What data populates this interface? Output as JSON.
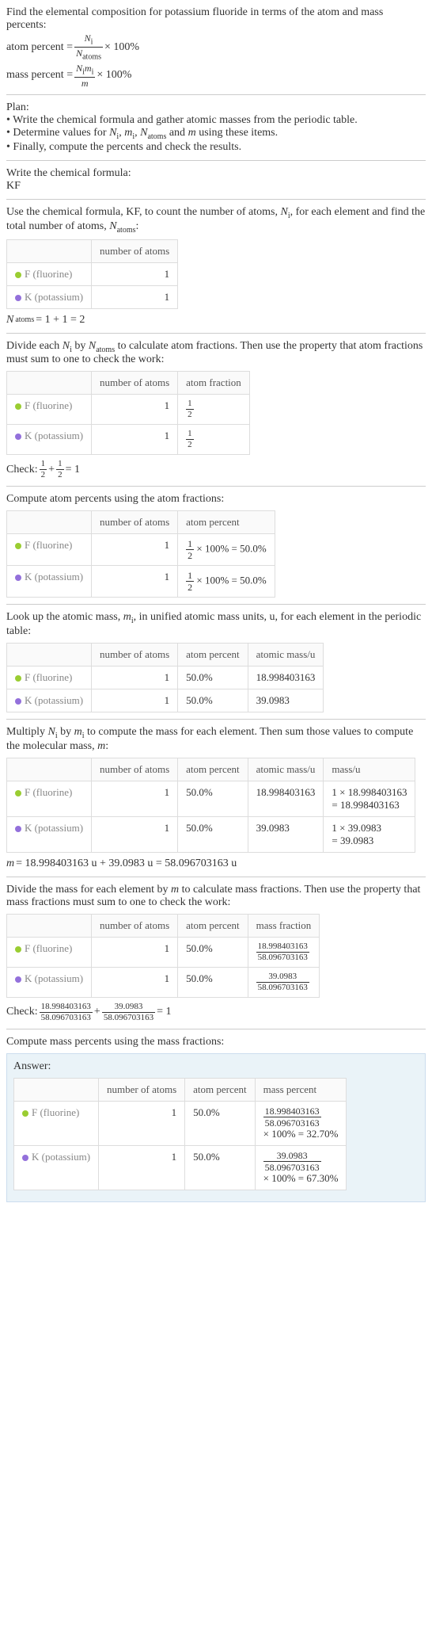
{
  "intro": {
    "title": "Find the elemental composition for potassium fluoride in terms of the atom and mass percents:",
    "atom_label": "atom percent =",
    "atom_num": "N_i",
    "atom_den": "N_atoms",
    "times100": "× 100%",
    "mass_label": "mass percent =",
    "mass_num": "N_i m_i",
    "mass_den": "m"
  },
  "plan": {
    "heading": "Plan:",
    "b1": "• Write the chemical formula and gather atomic masses from the periodic table.",
    "b2_pre": "• Determine values for ",
    "b2_vars": "N_i, m_i, N_atoms and m",
    "b2_post": " using these items.",
    "b3": "• Finally, compute the percents and check the results."
  },
  "formula": {
    "heading": "Write the chemical formula:",
    "value": "KF"
  },
  "count": {
    "intro_pre": "Use the chemical formula, KF, to count the number of atoms, ",
    "intro_ni": "N_i",
    "intro_mid": ", for each element and find the total number of atoms, ",
    "intro_na": "N_atoms",
    "intro_end": ":",
    "col_atoms": "number of atoms",
    "f_label": "F (fluorine)",
    "k_label": "K (potassium)",
    "f_n": "1",
    "k_n": "1",
    "sum_label": "N_atoms",
    "sum_expr": " = 1 + 1 = 2"
  },
  "atomfrac": {
    "intro": "Divide each N_i by N_atoms to calculate atom fractions. Then use the property that atom fractions must sum to one to check the work:",
    "col_atoms": "number of atoms",
    "col_frac": "atom fraction",
    "f_n": "1",
    "k_n": "1",
    "half_num": "1",
    "half_den": "2",
    "check_pre": "Check: ",
    "check_plus": " + ",
    "check_eq": " = 1"
  },
  "atompct": {
    "intro": "Compute atom percents using the atom fractions:",
    "col_atoms": "number of atoms",
    "col_pct": "atom percent",
    "f_n": "1",
    "k_n": "1",
    "expr_mid": " × 100% = 50.0%"
  },
  "atomicmass": {
    "intro_pre": "Look up the atomic mass, ",
    "intro_mi": "m_i",
    "intro_post": ", in unified atomic mass units, u, for each element in the periodic table:",
    "col_atoms": "number of atoms",
    "col_pct": "atom percent",
    "col_mass": "atomic mass/u",
    "f_n": "1",
    "k_n": "1",
    "f_pct": "50.0%",
    "k_pct": "50.0%",
    "f_mass": "18.998403163",
    "k_mass": "39.0983"
  },
  "massmul": {
    "intro_pre": "Multiply ",
    "intro_ni": "N_i",
    "intro_by": " by ",
    "intro_mi": "m_i",
    "intro_post": " to compute the mass for each element. Then sum those values to compute the molecular mass, ",
    "intro_m": "m",
    "intro_end": ":",
    "col_atoms": "number of atoms",
    "col_pct": "atom percent",
    "col_amass": "atomic mass/u",
    "col_mass": "mass/u",
    "f_n": "1",
    "k_n": "1",
    "f_pct": "50.0%",
    "k_pct": "50.0%",
    "f_amass": "18.998403163",
    "k_amass": "39.0983",
    "f_mass_a": "1 × 18.998403163",
    "f_mass_b": "= 18.998403163",
    "k_mass_a": "1 × 39.0983",
    "k_mass_b": "= 39.0983",
    "sum_m": "m",
    "sum_expr": " = 18.998403163 u + 39.0983 u = 58.096703163 u"
  },
  "massfrac": {
    "intro": "Divide the mass for each element by m to calculate mass fractions. Then use the property that mass fractions must sum to one to check the work:",
    "col_atoms": "number of atoms",
    "col_pct": "atom percent",
    "col_mfrac": "mass fraction",
    "f_n": "1",
    "k_n": "1",
    "f_pct": "50.0%",
    "k_pct": "50.0%",
    "f_num": "18.998403163",
    "den": "58.096703163",
    "k_num": "39.0983",
    "check_pre": "Check: ",
    "check_plus": " + ",
    "check_eq": " = 1"
  },
  "masspct": {
    "intro": "Compute mass percents using the mass fractions:"
  },
  "answer": {
    "heading": "Answer:",
    "col_atoms": "number of atoms",
    "col_pct": "atom percent",
    "col_mpct": "mass percent",
    "f_n": "1",
    "k_n": "1",
    "f_pct": "50.0%",
    "k_pct": "50.0%",
    "f_num": "18.998403163",
    "den": "58.096703163",
    "f_res": "× 100% = 32.70%",
    "k_num": "39.0983",
    "k_res": "× 100% = 67.30%"
  },
  "chart_data": {
    "type": "table",
    "title": "Elemental composition of potassium fluoride (KF)",
    "elements": [
      {
        "symbol": "F",
        "name": "fluorine",
        "num_atoms": 1,
        "atom_fraction": 0.5,
        "atom_percent": 50.0,
        "atomic_mass_u": 18.998403163,
        "mass_u": 18.998403163,
        "mass_fraction": 0.327,
        "mass_percent": 32.7
      },
      {
        "symbol": "K",
        "name": "potassium",
        "num_atoms": 1,
        "atom_fraction": 0.5,
        "atom_percent": 50.0,
        "atomic_mass_u": 39.0983,
        "mass_u": 39.0983,
        "mass_fraction": 0.673,
        "mass_percent": 67.3
      }
    ],
    "N_atoms": 2,
    "molecular_mass_u": 58.096703163
  }
}
